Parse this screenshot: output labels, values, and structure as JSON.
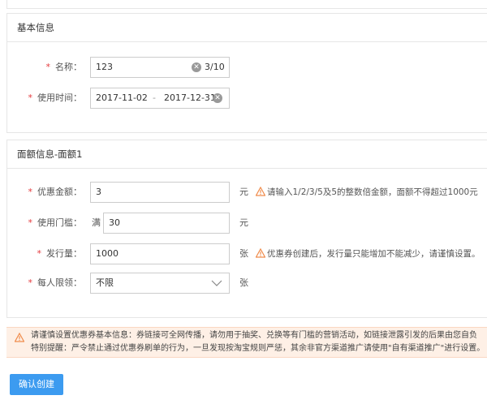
{
  "basic": {
    "header": "基本信息",
    "name_label": "名称：",
    "name_value": "123",
    "name_counter": "3/10",
    "time_label": "使用时间：",
    "start_date": "2017-11-02",
    "range_sep": "-",
    "end_date": "2017-12-31"
  },
  "face": {
    "header": "面额信息-面额1",
    "amount_label": "优惠金额：",
    "amount_value": "3",
    "amount_unit": "元",
    "amount_hint": "请输入1/2/3/5及5的整数倍金额，面额不得超过1000元",
    "threshold_label": "使用门槛：",
    "threshold_prefix": "满",
    "threshold_value": "30",
    "threshold_unit": "元",
    "issue_label": "发行量：",
    "issue_value": "1000",
    "issue_unit": "张",
    "issue_hint": "优惠券创建后，发行量只能增加不能减少，请谨慎设置。",
    "limit_label": "每人限领：",
    "limit_value": "不限",
    "limit_unit": "张"
  },
  "notice": {
    "line1": "请谨慎设置优惠券基本信息：券链接可全网传播，请勿用于抽奖、兑换等有门槛的营销活动，如链接泄露引发的后果由您自负",
    "line2": "特别提醒：严令禁止通过优惠券刷单的行为，一旦发现按淘宝规则严惩，其余非官方渠道推广请使用\"自有渠道推广\"进行设置。"
  },
  "actions": {
    "submit_label": "确认创建"
  },
  "colors": {
    "required": "#e4393c",
    "warning": "#f08c4c",
    "primary": "#3c9bf0",
    "notice_bg": "#fef0e6"
  }
}
